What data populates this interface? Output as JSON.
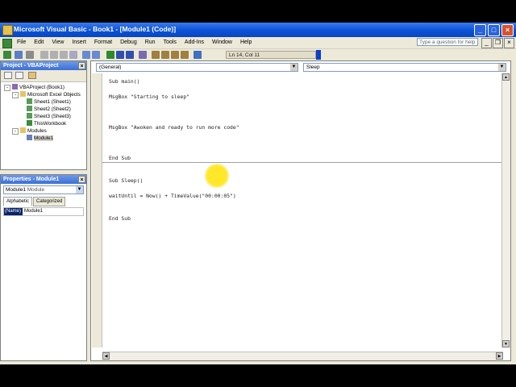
{
  "window": {
    "title": "Microsoft Visual Basic - Book1 - [Module1 (Code)]"
  },
  "menu": {
    "items": [
      "File",
      "Edit",
      "View",
      "Insert",
      "Format",
      "Debug",
      "Run",
      "Tools",
      "Add-Ins",
      "Window",
      "Help"
    ],
    "help_placeholder": "Type a question for help"
  },
  "toolbar": {
    "position": "Ln 14, Col 11"
  },
  "project": {
    "title": "Project - VBAProject",
    "tree": [
      {
        "label": "VBAProject (Book1)",
        "level": 0,
        "icon": "project-icon",
        "expander": "-"
      },
      {
        "label": "Microsoft Excel Objects",
        "level": 1,
        "icon": "folder-icon",
        "expander": "-"
      },
      {
        "label": "Sheet1 (Sheet1)",
        "level": 2,
        "icon": "sheet-icon"
      },
      {
        "label": "Sheet2 (Sheet2)",
        "level": 2,
        "icon": "sheet-icon"
      },
      {
        "label": "Sheet3 (Sheet3)",
        "level": 2,
        "icon": "sheet-icon"
      },
      {
        "label": "ThisWorkbook",
        "level": 2,
        "icon": "workbook-icon"
      },
      {
        "label": "Modules",
        "level": 1,
        "icon": "folder-icon",
        "expander": "-"
      },
      {
        "label": "Module1",
        "level": 2,
        "icon": "module-icon",
        "selected": true
      }
    ]
  },
  "properties": {
    "title": "Properties - Module1",
    "object_name": "Module1",
    "object_type": "Module",
    "tabs": [
      "Alphabetic",
      "Categorized"
    ],
    "rows": [
      {
        "name": "(Name)",
        "value": "Module1"
      }
    ]
  },
  "code": {
    "object_combo": "(General)",
    "proc_combo": "Sleep",
    "lines": [
      "Sub main()",
      "MsgBox \"Starting to sleep\"",
      "MsgBox \"Awoken and ready to run more code\"",
      "End Sub",
      "Sub Sleep()",
      "waitUntil = Now() + TimeValue(\"00:00:05\")",
      "End Sub"
    ]
  },
  "colors": {
    "title_bar": "#0a52d6",
    "selection": "#0a246a",
    "highlight": "#ffe61e"
  }
}
